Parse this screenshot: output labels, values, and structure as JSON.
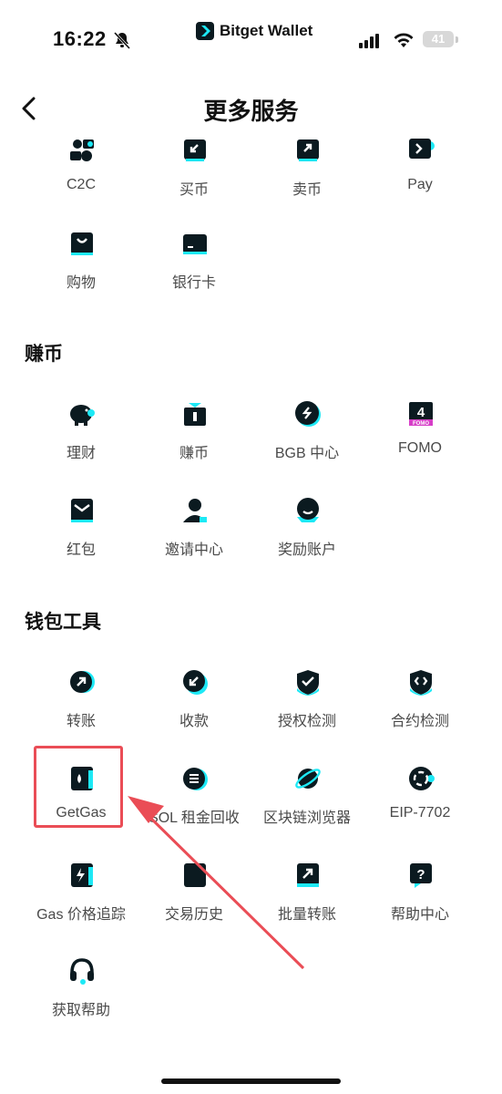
{
  "status_bar": {
    "time": "16:22",
    "battery": "41"
  },
  "brand": {
    "name": "Bitget Wallet"
  },
  "header": {
    "title": "更多服务"
  },
  "sections": {
    "top": {
      "items": [
        {
          "label": "C2C",
          "icon": "c2c-icon"
        },
        {
          "label": "买币",
          "icon": "buy-crypto-icon"
        },
        {
          "label": "卖币",
          "icon": "sell-crypto-icon"
        },
        {
          "label": "Pay",
          "icon": "pay-icon"
        },
        {
          "label": "购物",
          "icon": "shopping-bag-icon"
        },
        {
          "label": "银行卡",
          "icon": "bank-card-icon"
        }
      ]
    },
    "earn": {
      "title": "赚币",
      "items": [
        {
          "label": "理财",
          "icon": "piggy-bank-icon"
        },
        {
          "label": "赚币",
          "icon": "gift-icon"
        },
        {
          "label": "BGB 中心",
          "icon": "bgb-icon"
        },
        {
          "label": "FOMO",
          "icon": "fomo-icon",
          "badge": "4",
          "badge_text": "FOMO"
        },
        {
          "label": "红包",
          "icon": "red-envelope-icon"
        },
        {
          "label": "邀请中心",
          "icon": "invite-user-icon"
        },
        {
          "label": "奖励账户",
          "icon": "reward-icon"
        }
      ]
    },
    "tools": {
      "title": "钱包工具",
      "items": [
        {
          "label": "转账",
          "icon": "send-arrow-icon"
        },
        {
          "label": "收款",
          "icon": "receive-arrow-icon"
        },
        {
          "label": "授权检测",
          "icon": "shield-check-icon"
        },
        {
          "label": "合约检测",
          "icon": "contract-shield-icon"
        },
        {
          "label": "GetGas",
          "icon": "gas-pump-icon"
        },
        {
          "label": "SOL 租金回收",
          "icon": "sol-icon"
        },
        {
          "label": "区块链浏览器",
          "icon": "explorer-planet-icon"
        },
        {
          "label": "EIP-7702",
          "icon": "eip-icon"
        },
        {
          "label": "Gas 价格追踪",
          "icon": "gas-price-icon"
        },
        {
          "label": "交易历史",
          "icon": "history-icon"
        },
        {
          "label": "批量转账",
          "icon": "batch-transfer-icon"
        },
        {
          "label": "帮助中心",
          "icon": "help-icon"
        },
        {
          "label": "获取帮助",
          "icon": "headset-icon"
        }
      ]
    }
  },
  "colors": {
    "accent": "#1de9f6",
    "dark": "#0b1a20",
    "highlight": "#ea4d56",
    "label": "#4a4a4a"
  }
}
